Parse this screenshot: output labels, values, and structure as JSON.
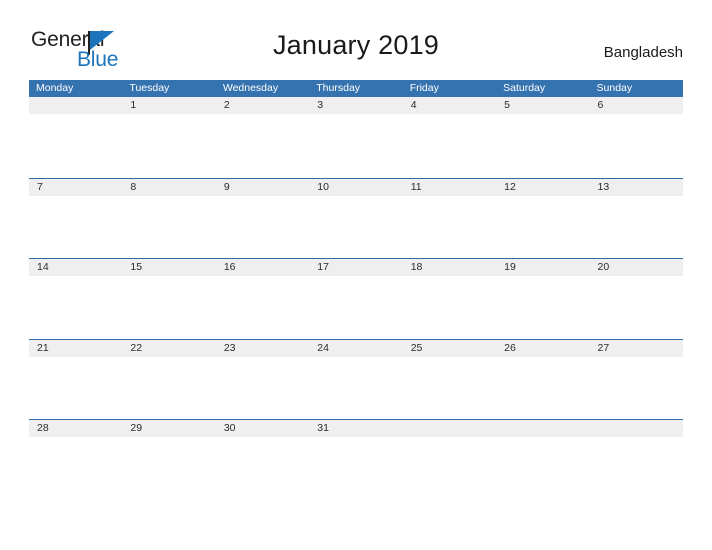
{
  "logo": {
    "word_one": "General",
    "word_two": "Blue",
    "flag_icon": "blue-flag-icon",
    "color_dark": "#231f20",
    "color_blue": "#1c75bc"
  },
  "header": {
    "title": "January 2019",
    "region": "Bangladesh"
  },
  "calendar": {
    "header_color": "#3573b0",
    "rule_color": "#2e6da4",
    "date_band_color": "#efefef",
    "weekdays": [
      "Monday",
      "Tuesday",
      "Wednesday",
      "Thursday",
      "Friday",
      "Saturday",
      "Sunday"
    ],
    "weeks": [
      [
        "",
        "1",
        "2",
        "3",
        "4",
        "5",
        "6"
      ],
      [
        "7",
        "8",
        "9",
        "10",
        "11",
        "12",
        "13"
      ],
      [
        "14",
        "15",
        "16",
        "17",
        "18",
        "19",
        "20"
      ],
      [
        "21",
        "22",
        "23",
        "24",
        "25",
        "26",
        "27"
      ],
      [
        "28",
        "29",
        "30",
        "31",
        "",
        "",
        ""
      ]
    ]
  }
}
